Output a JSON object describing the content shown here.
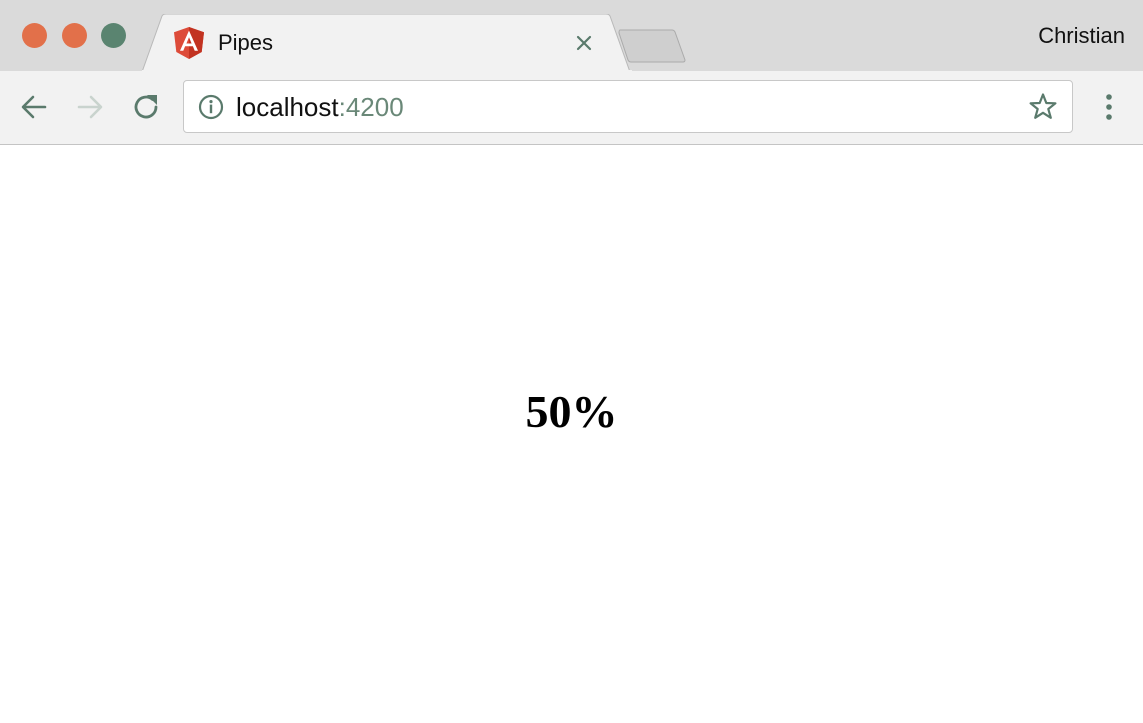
{
  "window": {
    "traffic_lights": {
      "close": "#e2704a",
      "minimize": "#e2704a",
      "maximize": "#5a8470"
    }
  },
  "tabs": [
    {
      "title": "Pipes",
      "favicon": "angular-logo-icon",
      "active": true
    }
  ],
  "profile": {
    "name": "Christian"
  },
  "toolbar": {
    "back_icon": "arrow-left-icon",
    "forward_icon": "arrow-right-icon",
    "reload_icon": "reload-icon",
    "menu_icon": "kebab-menu-icon"
  },
  "address_bar": {
    "site_info_icon": "info-icon",
    "host": "localhost",
    "port": ":4200",
    "bookmark_icon": "star-icon"
  },
  "page": {
    "content": "50%"
  },
  "colors": {
    "tabstrip_bg": "#dadada",
    "toolbar_bg": "#f2f2f2",
    "accent": "#5a8470",
    "angular_red": "#dd4b39"
  }
}
